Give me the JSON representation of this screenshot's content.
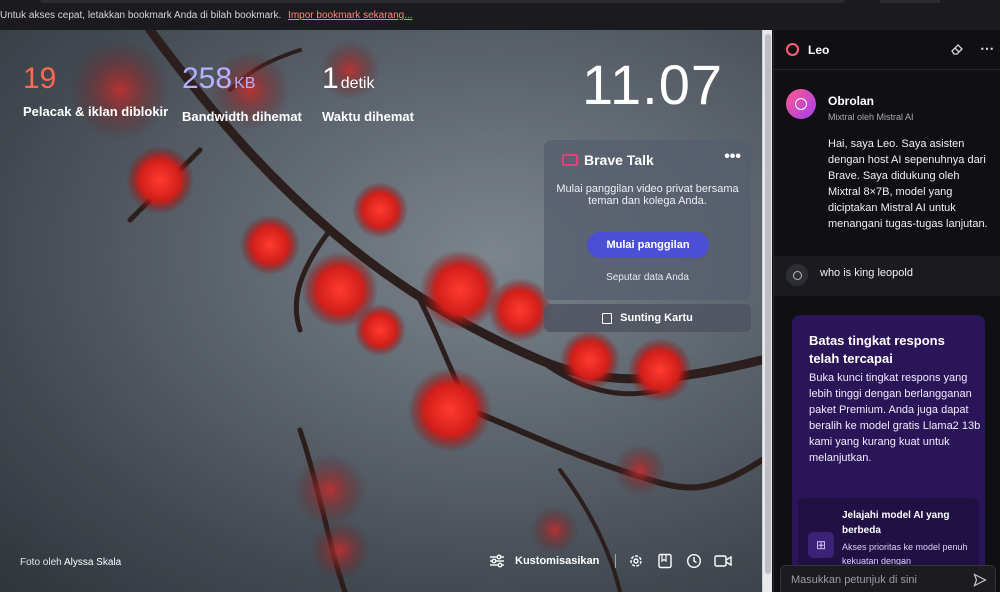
{
  "bookmark_bar": {
    "message": "Untuk akses cepat, letakkan bookmark Anda di bilah bookmark.",
    "import_link": "Impor bookmark sekarang..."
  },
  "stats": {
    "trackers": {
      "value": "19",
      "label": "Pelacak & iklan diblokir"
    },
    "bandwidth": {
      "value": "258",
      "unit": "KB",
      "label": "Bandwidth dihemat"
    },
    "time": {
      "value": "1",
      "unit": "detik",
      "label": "Waktu dihemat"
    }
  },
  "clock": "11.07",
  "brave_talk": {
    "title": "Brave Talk",
    "description": "Mulai panggilan video privat bersama teman dan kolega Anda.",
    "start_button": "Mulai panggilan",
    "data_link": "Seputar data Anda",
    "edit_card": "Sunting Kartu"
  },
  "footer": {
    "photo_prefix": "Foto oleh",
    "photographer": "Alyssa Skala",
    "customize": "Kustomisasikan"
  },
  "leo": {
    "title": "Leo",
    "chat_name": "Obrolan",
    "chat_sub": "Mixtral oleh Mistral AI",
    "intro": "Hai, saya Leo. Saya asisten dengan host AI sepenuhnya dari Brave. Saya didukung oleh Mixtral 8×7B, model yang diciptakan Mistral AI untuk menangani tugas-tugas lanjutan.",
    "user_message": "who is king leopold",
    "limit_title": "Batas tingkat respons telah tercapai",
    "limit_body": "Buka kunci tingkat respons yang lebih tinggi dengan berlangganan paket Premium. Anda juga dapat beralih ke model gratis Llama2 13b kami yang kurang kuat untuk melanjutkan.",
    "explore_title": "Jelajahi model AI yang berbeda",
    "explore_desc": "Akses prioritas ke model penuh kekuatan dengan",
    "prompt_placeholder": "Masukkan petunjuk di sini"
  },
  "colors": {
    "trackers": "#ff6a4d",
    "bandwidth": "#b7b0ff",
    "talk_button": "#4a4fd6",
    "limit_card": "#2a1558"
  },
  "icons": [
    "brave-talk-icon",
    "more-icon",
    "edit-card-icon",
    "customize-icon",
    "settings-icon",
    "bookmarks-icon",
    "history-icon",
    "video-icon",
    "leo-logo-icon",
    "erase-icon",
    "user-icon",
    "model-icon",
    "send-icon"
  ]
}
